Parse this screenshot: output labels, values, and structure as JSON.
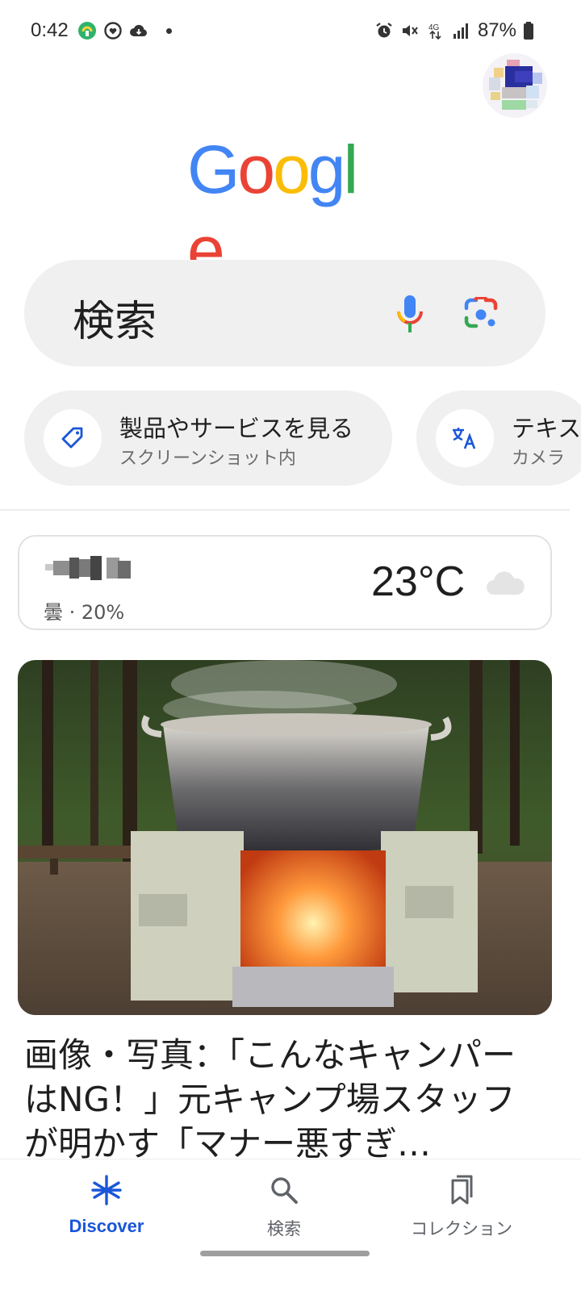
{
  "status_bar": {
    "time": "0:42",
    "battery": "87%",
    "network": "4G",
    "left_icons": [
      "app-notification-icon",
      "heart-app-icon",
      "cloud-sync-icon"
    ],
    "right_icons": [
      "alarm-icon",
      "vibrate-mute-icon",
      "network-4g-icon",
      "signal-icon",
      "battery-icon"
    ]
  },
  "header": {
    "logo": [
      "G",
      "o",
      "o",
      "g",
      "l",
      "e"
    ],
    "logo_colors": [
      "#4285F4",
      "#EA4335",
      "#FBBC05",
      "#4285F4",
      "#34A853",
      "#EA4335"
    ]
  },
  "search": {
    "placeholder": "検索",
    "icons": [
      "mic-icon",
      "lens-icon"
    ]
  },
  "chips": [
    {
      "title": "製品やサービスを見る",
      "subtitle": "スクリーンショット内",
      "icon": "tag-icon"
    },
    {
      "title": "テキス",
      "subtitle": "カメラ",
      "icon": "translate-icon"
    }
  ],
  "weather": {
    "condition": "曇 · 20%",
    "temperature": "23°C",
    "icon": "cloud-icon"
  },
  "article": {
    "title": "画像・写真：「こんなキャンパーはNG！」元キャンプ場スタッフが明かす「マナー悪すぎ…",
    "image_description_icon": "article-image"
  },
  "bottom_nav": [
    {
      "label": "Discover",
      "icon": "discover-icon",
      "active": true
    },
    {
      "label": "検索",
      "icon": "search-icon",
      "active": false
    },
    {
      "label": "コレクション",
      "icon": "collections-icon",
      "active": false
    }
  ],
  "colors": {
    "accent": "#1a56d8",
    "chip_bg": "#f0f0f0"
  }
}
